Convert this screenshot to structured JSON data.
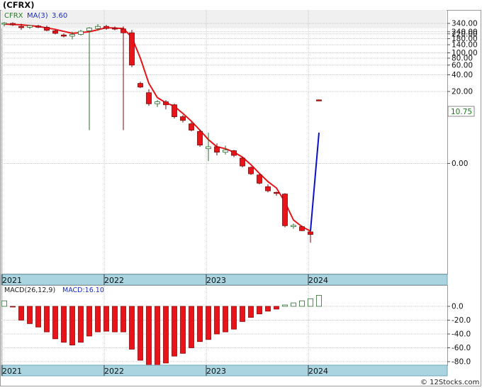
{
  "title": "(CFRX)",
  "footer": "© 12Stocks.com",
  "colors": {
    "up": "#2e8b2e",
    "down": "#e8141a",
    "ma": "#e8141a",
    "ma_extension": "#0a12c8",
    "macd_legend": "#1a2cc8",
    "axis_band": "#a9d4e0",
    "price_tag_text": "#1a7a1a"
  },
  "chart_data": [
    {
      "type": "candlestick",
      "title": "",
      "symbol": "CFRX",
      "legend": {
        "symbol_label": "CFRX",
        "ma_label": "MA(3)",
        "ma_value": "3.60"
      },
      "y_scale": "log",
      "y_ticks": [
        "340.00",
        "240.00",
        "220.00",
        "180.00",
        "140.00",
        "100.00",
        "80.00",
        "60.00",
        "40.00",
        "20.00",
        "0.00"
      ],
      "y_tick_values": [
        340,
        240,
        220,
        180,
        140,
        100,
        80,
        60,
        40,
        20,
        1
      ],
      "x_ticks": [
        "2021",
        "2022",
        "2023",
        "2024"
      ],
      "x_tick_dates": [
        "2021-01",
        "2022-01",
        "2023-01",
        "2024-01"
      ],
      "last_price": "10.75",
      "last_price_value": 10.75,
      "candles": [
        {
          "date": "2021-01",
          "open": 330,
          "high": 360,
          "low": 300,
          "close": 345
        },
        {
          "date": "2021-02",
          "open": 340,
          "high": 355,
          "low": 305,
          "close": 320
        },
        {
          "date": "2021-03",
          "open": 300,
          "high": 335,
          "low": 260,
          "close": 285
        },
        {
          "date": "2021-04",
          "open": 290,
          "high": 320,
          "low": 270,
          "close": 310
        },
        {
          "date": "2021-05",
          "open": 305,
          "high": 320,
          "low": 280,
          "close": 290
        },
        {
          "date": "2021-06",
          "open": 290,
          "high": 310,
          "low": 245,
          "close": 255
        },
        {
          "date": "2021-07",
          "open": 250,
          "high": 265,
          "low": 215,
          "close": 225
        },
        {
          "date": "2021-08",
          "open": 210,
          "high": 225,
          "low": 190,
          "close": 200
        },
        {
          "date": "2021-09",
          "open": 200,
          "high": 240,
          "low": 175,
          "close": 215
        },
        {
          "date": "2021-10",
          "open": 215,
          "high": 260,
          "low": 205,
          "close": 245
        },
        {
          "date": "2021-11",
          "open": 250,
          "high": 290,
          "low": 4,
          "close": 280
        },
        {
          "date": "2021-12",
          "open": 275,
          "high": 330,
          "low": 250,
          "close": 300
        },
        {
          "date": "2022-01",
          "open": 300,
          "high": 320,
          "low": 260,
          "close": 275
        },
        {
          "date": "2022-02",
          "open": 280,
          "high": 300,
          "low": 255,
          "close": 270
        },
        {
          "date": "2022-03",
          "open": 270,
          "high": 300,
          "low": 4,
          "close": 230
        },
        {
          "date": "2022-04",
          "open": 230,
          "high": 260,
          "low": 55,
          "close": 60
        },
        {
          "date": "2022-05",
          "open": 28,
          "high": 30,
          "low": 23,
          "close": 24
        },
        {
          "date": "2022-06",
          "open": 19,
          "high": 22,
          "low": 11,
          "close": 12
        },
        {
          "date": "2022-07",
          "open": 12,
          "high": 14,
          "low": 10.5,
          "close": 13
        },
        {
          "date": "2022-08",
          "open": 13,
          "high": 14,
          "low": 9.5,
          "close": 11.5
        },
        {
          "date": "2022-09",
          "open": 11.5,
          "high": 12,
          "low": 6.5,
          "close": 7
        },
        {
          "date": "2022-10",
          "open": 7,
          "high": 7.5,
          "low": 5.5,
          "close": 6
        },
        {
          "date": "2022-11",
          "open": 5.2,
          "high": 5.6,
          "low": 3.8,
          "close": 4
        },
        {
          "date": "2022-12",
          "open": 3.8,
          "high": 4.1,
          "low": 2.0,
          "close": 2.15
        },
        {
          "date": "2023-01",
          "open": 1.85,
          "high": 3.6,
          "low": 1.1,
          "close": 2.0
        },
        {
          "date": "2023-02",
          "open": 2.0,
          "high": 2.3,
          "low": 1.4,
          "close": 1.6
        },
        {
          "date": "2023-03",
          "open": 1.6,
          "high": 2.1,
          "low": 1.45,
          "close": 1.75
        },
        {
          "date": "2023-04",
          "open": 1.7,
          "high": 1.75,
          "low": 1.3,
          "close": 1.4
        },
        {
          "date": "2023-05",
          "open": 1.25,
          "high": 1.3,
          "low": 0.85,
          "close": 0.9
        },
        {
          "date": "2023-06",
          "open": 0.85,
          "high": 0.88,
          "low": 0.62,
          "close": 0.65
        },
        {
          "date": "2023-07",
          "open": 0.62,
          "high": 0.65,
          "low": 0.42,
          "close": 0.44
        },
        {
          "date": "2023-08",
          "open": 0.38,
          "high": 0.42,
          "low": 0.3,
          "close": 0.32
        },
        {
          "date": "2023-09",
          "open": 0.3,
          "high": 0.31,
          "low": 0.26,
          "close": 0.29
        },
        {
          "date": "2023-10",
          "open": 0.28,
          "high": 0.29,
          "low": 0.07,
          "close": 0.075
        },
        {
          "date": "2023-11",
          "open": 0.072,
          "high": 0.082,
          "low": 0.066,
          "close": 0.076
        },
        {
          "date": "2023-12",
          "open": 0.072,
          "high": 0.075,
          "low": 0.06,
          "close": 0.061
        },
        {
          "date": "2024-01",
          "open": 0.058,
          "high": 0.06,
          "low": 0.037,
          "close": 0.052
        },
        {
          "date": "2024-02",
          "open": 14.1,
          "high": 14.3,
          "low": 13.9,
          "close": 14.0
        }
      ],
      "ma": [
        {
          "date": "2021-01",
          "value": 330
        },
        {
          "date": "2021-03",
          "value": 320
        },
        {
          "date": "2021-05",
          "value": 300
        },
        {
          "date": "2021-07",
          "value": 265
        },
        {
          "date": "2021-09",
          "value": 225
        },
        {
          "date": "2021-11",
          "value": 240
        },
        {
          "date": "2022-01",
          "value": 285
        },
        {
          "date": "2022-03",
          "value": 275
        },
        {
          "date": "2022-04",
          "value": 190
        },
        {
          "date": "2022-05",
          "value": 80
        },
        {
          "date": "2022-06",
          "value": 28
        },
        {
          "date": "2022-07",
          "value": 15.5
        },
        {
          "date": "2022-08",
          "value": 12.5
        },
        {
          "date": "2022-09",
          "value": 10.8
        },
        {
          "date": "2022-10",
          "value": 8
        },
        {
          "date": "2022-11",
          "value": 5.8
        },
        {
          "date": "2022-12",
          "value": 4.0
        },
        {
          "date": "2023-01",
          "value": 2.7
        },
        {
          "date": "2023-02",
          "value": 2.0
        },
        {
          "date": "2023-03",
          "value": 1.85
        },
        {
          "date": "2023-04",
          "value": 1.6
        },
        {
          "date": "2023-05",
          "value": 1.3
        },
        {
          "date": "2023-06",
          "value": 0.95
        },
        {
          "date": "2023-07",
          "value": 0.66
        },
        {
          "date": "2023-08",
          "value": 0.47
        },
        {
          "date": "2023-09",
          "value": 0.36
        },
        {
          "date": "2023-10",
          "value": 0.2
        },
        {
          "date": "2023-11",
          "value": 0.095
        },
        {
          "date": "2023-12",
          "value": 0.072
        },
        {
          "date": "2024-01",
          "value": 0.06
        }
      ],
      "ma_extension": [
        {
          "date": "2024-01",
          "value": 0.06
        },
        {
          "date": "2024-02",
          "value": 3.6
        }
      ]
    },
    {
      "type": "bar",
      "title": "",
      "legend": {
        "label": "MACD(26,12,9)",
        "value_label": "MACD:16.10"
      },
      "y_ticks": [
        "0.0",
        "-20.0",
        "-40.0",
        "-60.0",
        "-80.0"
      ],
      "y_tick_values": [
        0,
        -20,
        -40,
        -60,
        -80
      ],
      "ylim": [
        -86,
        20
      ],
      "x_ticks": [
        "2021",
        "2022",
        "2023",
        "2024"
      ],
      "bars": [
        {
          "date": "2021-01",
          "value": 8
        },
        {
          "date": "2021-02",
          "value": -1
        },
        {
          "date": "2021-03",
          "value": -20
        },
        {
          "date": "2021-04",
          "value": -25
        },
        {
          "date": "2021-05",
          "value": -30
        },
        {
          "date": "2021-06",
          "value": -37
        },
        {
          "date": "2021-07",
          "value": -47
        },
        {
          "date": "2021-08",
          "value": -52
        },
        {
          "date": "2021-09",
          "value": -56
        },
        {
          "date": "2021-10",
          "value": -52
        },
        {
          "date": "2021-11",
          "value": -43
        },
        {
          "date": "2021-12",
          "value": -37
        },
        {
          "date": "2022-01",
          "value": -36
        },
        {
          "date": "2022-02",
          "value": -37
        },
        {
          "date": "2022-03",
          "value": -37
        },
        {
          "date": "2022-04",
          "value": -62
        },
        {
          "date": "2022-05",
          "value": -78
        },
        {
          "date": "2022-06",
          "value": -85
        },
        {
          "date": "2022-07",
          "value": -86
        },
        {
          "date": "2022-08",
          "value": -82
        },
        {
          "date": "2022-09",
          "value": -72
        },
        {
          "date": "2022-10",
          "value": -68
        },
        {
          "date": "2022-11",
          "value": -60
        },
        {
          "date": "2022-12",
          "value": -51
        },
        {
          "date": "2023-01",
          "value": -48
        },
        {
          "date": "2023-02",
          "value": -40
        },
        {
          "date": "2023-03",
          "value": -37
        },
        {
          "date": "2023-04",
          "value": -33
        },
        {
          "date": "2023-05",
          "value": -22
        },
        {
          "date": "2023-06",
          "value": -16
        },
        {
          "date": "2023-07",
          "value": -11
        },
        {
          "date": "2023-08",
          "value": -7
        },
        {
          "date": "2023-09",
          "value": -4
        },
        {
          "date": "2023-10",
          "value": 2
        },
        {
          "date": "2023-11",
          "value": 5
        },
        {
          "date": "2023-12",
          "value": 8
        },
        {
          "date": "2024-01",
          "value": 11
        },
        {
          "date": "2024-02",
          "value": 16
        }
      ]
    }
  ]
}
